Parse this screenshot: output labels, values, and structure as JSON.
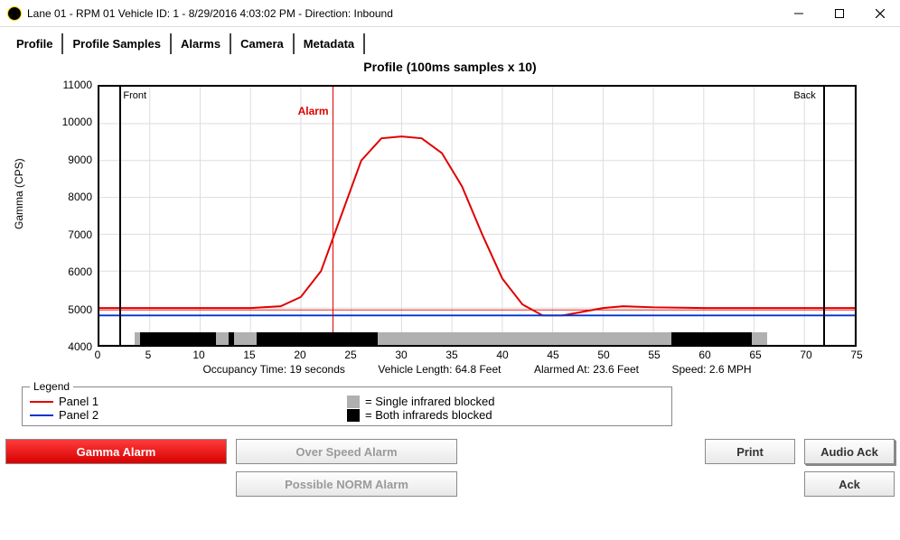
{
  "window": {
    "title": "Lane 01 - RPM 01  Vehicle ID: 1   - 8/29/2016 4:03:02 PM  - Direction: Inbound"
  },
  "tabs": [
    "Profile",
    "Profile Samples",
    "Alarms",
    "Camera",
    "Metadata"
  ],
  "chart": {
    "title": "Profile (100ms samples x 10)",
    "ylabel": "Gamma   (CPS)",
    "front_label": "Front",
    "back_label": "Back",
    "alarm_label": "Alarm"
  },
  "info": {
    "occupancy": "Occupancy Time: 19 seconds",
    "length": "Vehicle Length: 64.8 Feet",
    "alarmed": "Alarmed At: 23.6 Feet",
    "speed": "Speed: 2.6 MPH"
  },
  "legend": {
    "label": "Legend",
    "panel1": "Panel 1",
    "panel2": "Panel 2",
    "single": "= Single infrared blocked",
    "both": "= Both infrareds blocked"
  },
  "buttons": {
    "gamma": "Gamma Alarm",
    "overspeed": "Over Speed Alarm",
    "norm": "Possible NORM Alarm",
    "print": "Print",
    "audio_ack": "Audio Ack",
    "ack": "Ack"
  },
  "chart_data": {
    "type": "line",
    "xlabel": "",
    "ylabel": "Gamma (CPS)",
    "xlim": [
      0,
      75
    ],
    "ylim": [
      4000,
      11000
    ],
    "x_ticks": [
      0,
      5,
      10,
      15,
      20,
      25,
      30,
      35,
      40,
      45,
      50,
      55,
      60,
      65,
      70,
      75
    ],
    "y_ticks": [
      4000,
      5000,
      6000,
      7000,
      8000,
      9000,
      10000,
      11000
    ],
    "front_x": 2.0,
    "back_x": 71.5,
    "alarm_x": 23.0,
    "threshold_y": 4950,
    "series": [
      {
        "name": "Panel 1",
        "color": "#e00000",
        "x": [
          0,
          2,
          15,
          18,
          20,
          22,
          24,
          26,
          28,
          30,
          32,
          34,
          36,
          38,
          40,
          42,
          44,
          46,
          48,
          50,
          52,
          55,
          60,
          75
        ],
        "values": [
          5000,
          5000,
          5000,
          5050,
          5300,
          6000,
          7500,
          9000,
          9600,
          9650,
          9600,
          9200,
          8300,
          7000,
          5800,
          5100,
          4800,
          4800,
          4900,
          5000,
          5050,
          5020,
          5000,
          5000
        ]
      },
      {
        "name": "Panel 2",
        "color": "#0033cc",
        "x": [
          0,
          75
        ],
        "values": [
          4800,
          4800
        ]
      }
    ],
    "ir_segments": [
      {
        "type": "single",
        "x0": 3.5,
        "x1": 12.5
      },
      {
        "type": "both",
        "x0": 4.0,
        "x1": 11.5
      },
      {
        "type": "single",
        "x0": 12.5,
        "x1": 15.0
      },
      {
        "type": "both",
        "x0": 12.8,
        "x1": 13.3
      },
      {
        "type": "single",
        "x0": 15.0,
        "x1": 56.0
      },
      {
        "type": "both",
        "x0": 15.5,
        "x1": 27.5
      },
      {
        "type": "single",
        "x0": 56.0,
        "x1": 66.0
      },
      {
        "type": "both",
        "x0": 56.5,
        "x1": 64.5
      }
    ],
    "annotations": [
      {
        "text": "Front",
        "x": 2.0
      },
      {
        "text": "Back",
        "x": 71.5
      },
      {
        "text": "Alarm",
        "x": 23.0
      }
    ],
    "title": "Profile (100ms samples x 10)"
  }
}
